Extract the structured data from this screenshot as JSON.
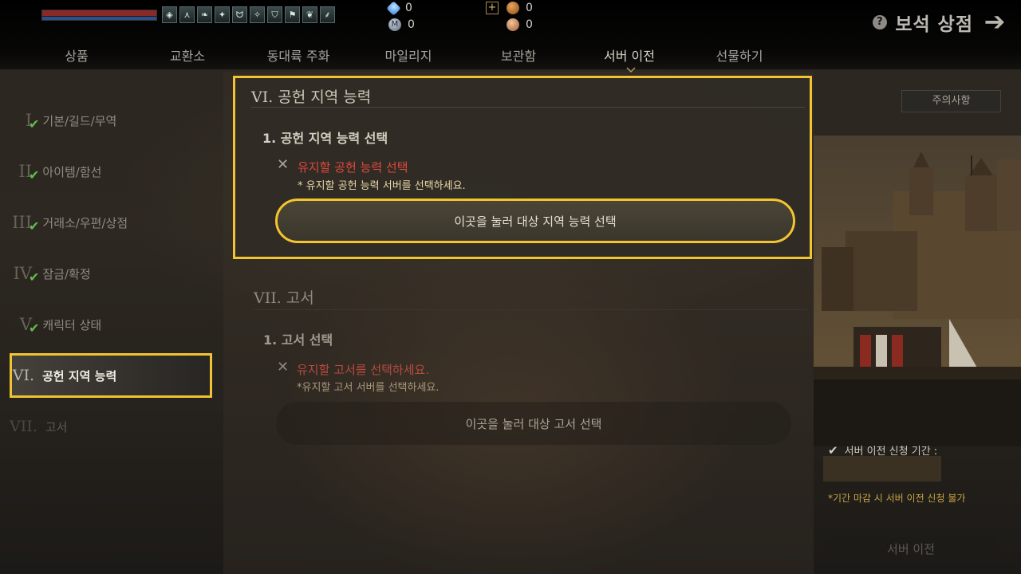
{
  "currencies": {
    "gem_count": "0",
    "mileage_count": "0",
    "bronze_count": "0",
    "coin_count": "0"
  },
  "header": {
    "shop_title": "보석 상점"
  },
  "tabs": [
    {
      "label": "상품"
    },
    {
      "label": "교환소"
    },
    {
      "label": "동대륙 주화"
    },
    {
      "label": "마일리지"
    },
    {
      "label": "보관함"
    },
    {
      "label": "서버 이전"
    },
    {
      "label": "선물하기"
    }
  ],
  "sidebar": {
    "items": [
      {
        "num": "I",
        "label": "기본/길드/무역",
        "checked": true
      },
      {
        "num": "II",
        "label": "아이템/함선",
        "checked": true
      },
      {
        "num": "III",
        "label": "거래소/우편/상점",
        "checked": true
      },
      {
        "num": "IV",
        "label": "잠금/확정",
        "checked": true
      },
      {
        "num": "V",
        "label": "캐릭터 상태",
        "checked": true
      },
      {
        "num": "VI.",
        "label": "공헌 지역 능력",
        "checked": false
      },
      {
        "num": "VII.",
        "label": "고서",
        "checked": false
      }
    ]
  },
  "section_vi": {
    "title": "VI. 공헌 지역 능력",
    "subtitle": "1. 공헌 지역 능력 선택",
    "warning": "유지할 공헌 능력 선택",
    "note": "* 유지할 공헌 능력 서버를 선택하세요.",
    "button": "이곳을 눌러 대상 지역 능력 선택"
  },
  "section_vii": {
    "title": "VII. 고서",
    "subtitle": "1. 고서 선택",
    "warning": "유지할 고서를 선택하세요.",
    "note": "*유지할 고서 서버를 선택하세요.",
    "button": "이곳을 눌러 대상 고서 선택"
  },
  "right_panel": {
    "notice_button": "주의사항",
    "apply_period_label": "서버 이전 신청 기간 :",
    "deadline_note": "*기간 마감 시 서버 이전 신청 불가",
    "transfer_button": "서버 이전"
  },
  "colors": {
    "highlight": "#f4c430",
    "warning_red": "#e0473c",
    "check_green": "#5fbf4e"
  }
}
